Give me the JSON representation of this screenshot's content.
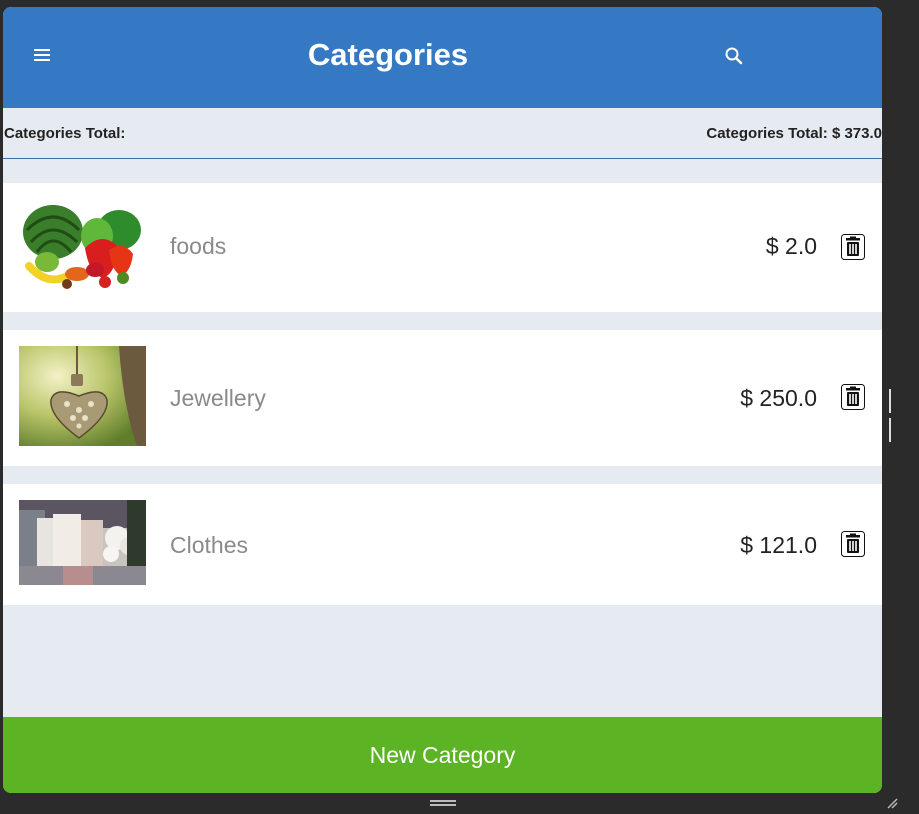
{
  "header": {
    "title": "Categories",
    "menu_icon": "hamburger-menu-icon",
    "search_icon": "search-icon"
  },
  "summary": {
    "left_label": "Categories Total:",
    "right_label": "Categories Total: $ 373.0"
  },
  "categories": [
    {
      "name": "foods",
      "price": "$ 2.0",
      "image": "vegetables-fruits-photo"
    },
    {
      "name": "Jewellery",
      "price": "$ 250.0",
      "image": "heart-pendant-photo"
    },
    {
      "name": "Clothes",
      "price": "$ 121.0",
      "image": "clothing-display-photo"
    }
  ],
  "footer": {
    "button_label": "New Category"
  },
  "colors": {
    "header_blue": "#3578c3",
    "footer_green": "#5cb324",
    "background": "#e6ebf2"
  }
}
